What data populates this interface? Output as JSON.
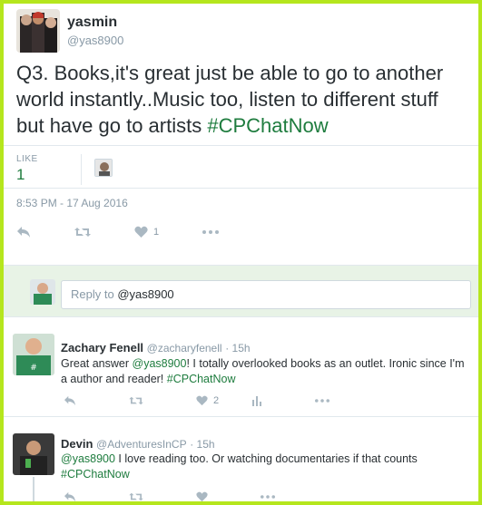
{
  "tweet": {
    "author_name": "yasmin",
    "author_handle": "@yas8900",
    "text_main": "Q3. Books,it's great just be able to go to another world instantly..Music too, listen to different stuff but have go to artists ",
    "hashtag": "#CPChatNow",
    "likes_label": "LIKE",
    "likes_count": "1",
    "timestamp": "8:53 PM - 17 Aug 2016",
    "like_action_count": "1"
  },
  "reply_box": {
    "prefix": "Reply to ",
    "mention": "@yas8900"
  },
  "replies": [
    {
      "name": "Zachary Fenell",
      "handle": "@zacharyfenell",
      "time": "· 15h",
      "text_a": "Great answer ",
      "mention": "@yas8900",
      "text_b": "! I totally overlooked books as an outlet. Ironic since I'm a author and reader! ",
      "hashtag": "#CPChatNow",
      "like_count": "2"
    },
    {
      "name": "Devin",
      "handle": "@AdventuresInCP",
      "time": "· 15h",
      "mention": "@yas8900",
      "text_b": " I love reading too. Or watching documentaries if that counts ",
      "hashtag": "#CPChatNow"
    }
  ],
  "colors": {
    "border": "#b5e61d",
    "accent": "#1e7c3e",
    "muted": "#8899a6",
    "reply_bg": "#e8f3e6"
  },
  "icons": [
    "reply-icon",
    "retweet-icon",
    "heart-icon",
    "more-icon",
    "analytics-icon"
  ]
}
